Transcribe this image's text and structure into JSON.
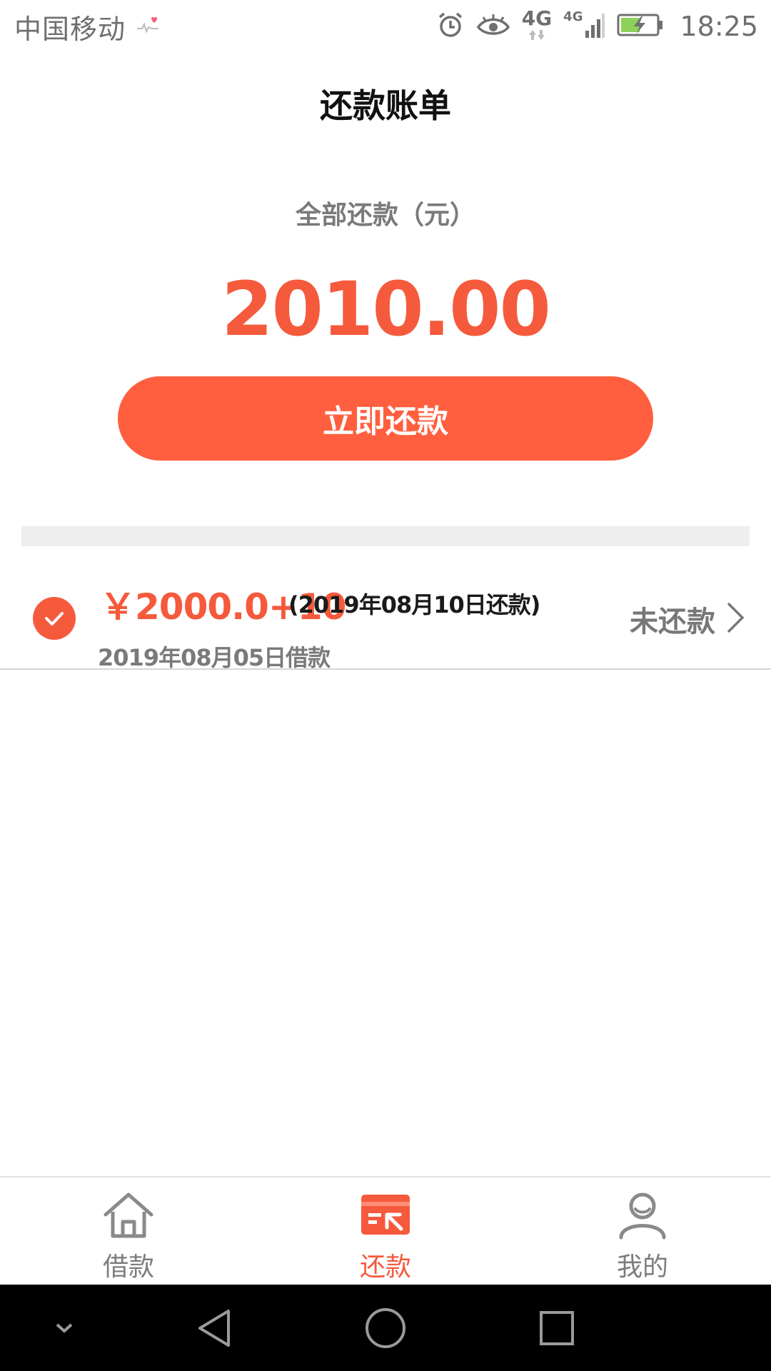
{
  "status_bar": {
    "carrier": "中国移动",
    "network_1": "4G",
    "network_2": "4G",
    "time": "18:25",
    "icons": [
      "heartbeat-icon",
      "alarm-icon",
      "eye-icon",
      "data-arrows-icon",
      "signal-icon",
      "battery-charging-icon"
    ]
  },
  "header": {
    "title": "还款账单"
  },
  "summary": {
    "label": "全部还款（元）",
    "amount": "2010.00",
    "button_label": "立即还款"
  },
  "bill": {
    "amount": "￥2000.0+10",
    "due": "(2019年08月10日还款)",
    "borrow_date": "2019年08月05日借款",
    "status": "未还款"
  },
  "bottom_nav": {
    "items": [
      {
        "label": "借款",
        "icon": "home-icon",
        "active": false
      },
      {
        "label": "还款",
        "icon": "repay-card-icon",
        "active": true
      },
      {
        "label": "我的",
        "icon": "user-icon",
        "active": false
      }
    ]
  },
  "system_nav": {
    "icons": [
      "chevron-down-icon",
      "back-triangle-icon",
      "home-circle-icon",
      "recents-square-icon"
    ]
  },
  "colors": {
    "accent": "#f55a3c",
    "button": "#ff5f3e",
    "muted_text": "#7a7a7a"
  }
}
